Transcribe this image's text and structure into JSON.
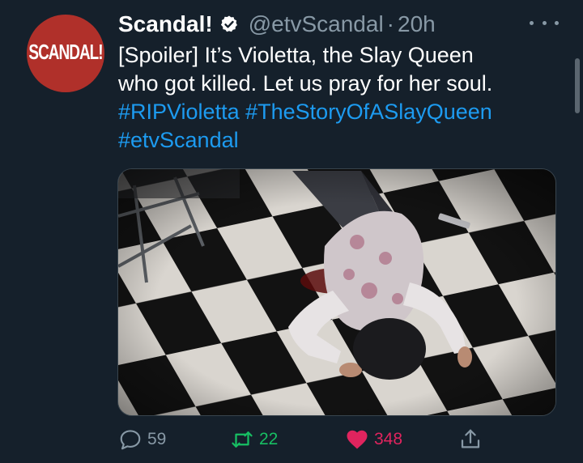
{
  "user": {
    "avatar_text": "SCANDAL!",
    "display_name": "Scandal!",
    "handle": "@etvScandal",
    "separator": "·",
    "time": "20h"
  },
  "tweet": {
    "text_line1": "[Spoiler] It’s Violetta, the Slay Queen",
    "text_line2": "who got killed. Let us pray for her soul.",
    "hashtag1": "#RIPVioletta",
    "hashtag2": "#TheStoryOfASlayQueen",
    "hashtag3": "#etvScandal"
  },
  "actions": {
    "reply_count": "59",
    "retweet_count": "22",
    "like_count": "348"
  },
  "colors": {
    "background": "#15202b",
    "link": "#1d9bf0",
    "secondary_text": "#8899a6",
    "retweet": "#17bf63",
    "like": "#e0245e",
    "avatar": "#b0302a"
  },
  "icons": [
    "verified-badge-icon",
    "more-options-icon",
    "reply-icon",
    "retweet-icon",
    "like-heart-icon",
    "share-icon"
  ]
}
